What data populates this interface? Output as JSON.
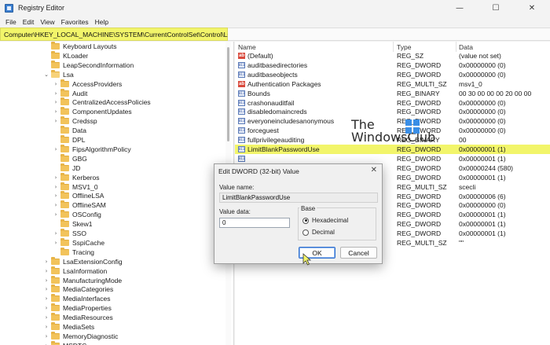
{
  "window": {
    "title": "Registry Editor",
    "minimize": "—",
    "maximize": "☐",
    "close": "✕"
  },
  "menu": [
    "File",
    "Edit",
    "View",
    "Favorites",
    "Help"
  ],
  "address": "Computer\\HKEY_LOCAL_MACHINE\\SYSTEM\\CurrentControlSet\\Control\\Lsa",
  "tree": [
    {
      "label": "Keyboard Layouts",
      "expandable": false,
      "open": false,
      "indent": 0
    },
    {
      "label": "KLoader",
      "expandable": false,
      "open": false,
      "indent": 0
    },
    {
      "label": "LeapSecondInformation",
      "expandable": false,
      "open": false,
      "indent": 0
    },
    {
      "label": "Lsa",
      "expandable": true,
      "open": true,
      "indent": 0
    },
    {
      "label": "AccessProviders",
      "expandable": true,
      "open": false,
      "indent": 1
    },
    {
      "label": "Audit",
      "expandable": true,
      "open": false,
      "indent": 1
    },
    {
      "label": "CentralizedAccessPolicies",
      "expandable": true,
      "open": false,
      "indent": 1
    },
    {
      "label": "ComponentUpdates",
      "expandable": true,
      "open": false,
      "indent": 1
    },
    {
      "label": "Credssp",
      "expandable": true,
      "open": false,
      "indent": 1
    },
    {
      "label": "Data",
      "expandable": false,
      "open": false,
      "indent": 1
    },
    {
      "label": "DPL",
      "expandable": false,
      "open": false,
      "indent": 1
    },
    {
      "label": "FipsAlgorithmPolicy",
      "expandable": true,
      "open": false,
      "indent": 1
    },
    {
      "label": "GBG",
      "expandable": false,
      "open": false,
      "indent": 1
    },
    {
      "label": "JD",
      "expandable": false,
      "open": false,
      "indent": 1
    },
    {
      "label": "Kerberos",
      "expandable": true,
      "open": false,
      "indent": 1
    },
    {
      "label": "MSV1_0",
      "expandable": true,
      "open": false,
      "indent": 1
    },
    {
      "label": "OfflineLSA",
      "expandable": true,
      "open": false,
      "indent": 1
    },
    {
      "label": "OfflineSAM",
      "expandable": true,
      "open": false,
      "indent": 1
    },
    {
      "label": "OSConfig",
      "expandable": true,
      "open": false,
      "indent": 1
    },
    {
      "label": "Skew1",
      "expandable": false,
      "open": false,
      "indent": 1
    },
    {
      "label": "SSO",
      "expandable": true,
      "open": false,
      "indent": 1
    },
    {
      "label": "SspiCache",
      "expandable": true,
      "open": false,
      "indent": 1
    },
    {
      "label": "Tracing",
      "expandable": false,
      "open": false,
      "indent": 1
    },
    {
      "label": "LsaExtensionConfig",
      "expandable": true,
      "open": false,
      "indent": 0
    },
    {
      "label": "LsaInformation",
      "expandable": true,
      "open": false,
      "indent": 0
    },
    {
      "label": "ManufacturingMode",
      "expandable": true,
      "open": false,
      "indent": 0
    },
    {
      "label": "MediaCategories",
      "expandable": true,
      "open": false,
      "indent": 0
    },
    {
      "label": "MediaInterfaces",
      "expandable": true,
      "open": false,
      "indent": 0
    },
    {
      "label": "MediaProperties",
      "expandable": true,
      "open": false,
      "indent": 0
    },
    {
      "label": "MediaResources",
      "expandable": true,
      "open": false,
      "indent": 0
    },
    {
      "label": "MediaSets",
      "expandable": true,
      "open": false,
      "indent": 0
    },
    {
      "label": "MemoryDiagnostic",
      "expandable": true,
      "open": false,
      "indent": 0
    },
    {
      "label": "MSDTC",
      "expandable": true,
      "open": false,
      "indent": 0
    }
  ],
  "columns": {
    "name": "Name",
    "type": "Type",
    "data": "Data"
  },
  "values": [
    {
      "name": "(Default)",
      "type": "REG_SZ",
      "data": "(value not set)",
      "icon": "string-value-icon",
      "highlight": false
    },
    {
      "name": "auditbasedirectories",
      "type": "REG_DWORD",
      "data": "0x00000000 (0)",
      "icon": "binary-value-icon",
      "highlight": false
    },
    {
      "name": "auditbaseobjects",
      "type": "REG_DWORD",
      "data": "0x00000000 (0)",
      "icon": "binary-value-icon",
      "highlight": false
    },
    {
      "name": "Authentication Packages",
      "type": "REG_MULTI_SZ",
      "data": "msv1_0",
      "icon": "string-value-icon",
      "highlight": false
    },
    {
      "name": "Bounds",
      "type": "REG_BINARY",
      "data": "00 30 00 00 00 20 00 00",
      "icon": "binary-value-icon",
      "highlight": false
    },
    {
      "name": "crashonauditfail",
      "type": "REG_DWORD",
      "data": "0x00000000 (0)",
      "icon": "binary-value-icon",
      "highlight": false
    },
    {
      "name": "disabledomaincreds",
      "type": "REG_DWORD",
      "data": "0x00000000 (0)",
      "icon": "binary-value-icon",
      "highlight": false
    },
    {
      "name": "everyoneincludesanonymous",
      "type": "REG_DWORD",
      "data": "0x00000000 (0)",
      "icon": "binary-value-icon",
      "highlight": false
    },
    {
      "name": "forceguest",
      "type": "REG_DWORD",
      "data": "0x00000000 (0)",
      "icon": "binary-value-icon",
      "highlight": false
    },
    {
      "name": "fullprivilegeauditing",
      "type": "REG_BINARY",
      "data": "00",
      "icon": "binary-value-icon",
      "highlight": false
    },
    {
      "name": "LimitBlankPasswordUse",
      "type": "REG_DWORD",
      "data": "0x00000001 (1)",
      "icon": "binary-value-icon",
      "highlight": true
    },
    {
      "name": "",
      "type": "REG_DWORD",
      "data": "0x00000001 (1)",
      "icon": "binary-value-icon",
      "highlight": false
    },
    {
      "name": "",
      "type": "REG_DWORD",
      "data": "0x00000244 (580)",
      "icon": "",
      "highlight": false
    },
    {
      "name": "",
      "type": "REG_DWORD",
      "data": "0x00000001 (1)",
      "icon": "",
      "highlight": false
    },
    {
      "name": "",
      "type": "REG_MULTI_SZ",
      "data": "scecli",
      "icon": "",
      "highlight": false
    },
    {
      "name": "",
      "type": "REG_DWORD",
      "data": "0x00000006 (6)",
      "icon": "",
      "highlight": false
    },
    {
      "name": "",
      "type": "REG_DWORD",
      "data": "0x00000000 (0)",
      "icon": "",
      "highlight": false
    },
    {
      "name": "",
      "type": "REG_DWORD",
      "data": "0x00000001 (1)",
      "icon": "",
      "highlight": false
    },
    {
      "name": "",
      "type": "REG_DWORD",
      "data": "0x00000001 (1)",
      "icon": "",
      "highlight": false
    },
    {
      "name": "",
      "type": "REG_DWORD",
      "data": "0x00000001 (1)",
      "icon": "",
      "highlight": false
    },
    {
      "name": "",
      "type": "REG_MULTI_SZ",
      "data": "\"\"",
      "icon": "",
      "highlight": false
    }
  ],
  "watermark": {
    "line1": "The",
    "line2": "WindowsClub"
  },
  "dialog": {
    "title": "Edit DWORD (32-bit) Value",
    "close": "✕",
    "value_name_label": "Value name:",
    "value_name": "LimitBlankPasswordUse",
    "value_data_label": "Value data:",
    "value_data": "0",
    "base_label": "Base",
    "hex_label": "Hexadecimal",
    "dec_label": "Decimal",
    "base_selected": "Hexadecimal",
    "ok": "OK",
    "cancel": "Cancel"
  },
  "colors": {
    "highlight": "#f2f56a",
    "accent": "#2f6fcd",
    "folder": "#f2c35b"
  }
}
